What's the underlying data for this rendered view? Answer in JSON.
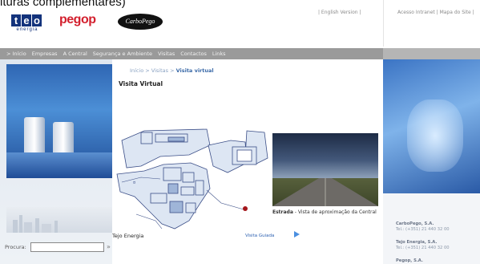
{
  "top_caption": "ituras complementares)",
  "header": {
    "logo_tejo": "tejo",
    "logo_tejo_sub": "energia",
    "logo_pegop": "pegop",
    "logo_carbo": "CarboPego",
    "english_version": "| English Version |",
    "intranet_links": "Acesso Intranet | Mapa do Site |"
  },
  "nav": {
    "items": [
      "> Início",
      "Empresas",
      "A Central",
      "Segurança e Ambiente",
      "Visitas",
      "Contactos",
      "Links"
    ]
  },
  "search": {
    "label": "Procura:",
    "value": "",
    "go": "»"
  },
  "main": {
    "breadcrumb_prefix": "Início > Visitas > ",
    "breadcrumb_current": "Visita virtual",
    "title": "Visita Virtual",
    "photo_caption_bold": "Estrada",
    "photo_caption_rest": " - Vista de aproximação da Central",
    "company_name": "Tejo Energia",
    "guided_link": "Visita Guiada"
  },
  "contacts": [
    {
      "name": "CarboPego, S.A.",
      "tel": "Tel.: (+351) 21 440 32 00"
    },
    {
      "name": "Tejo Energia, S.A.",
      "tel": "Tel.: (+351) 21 440 32 00"
    },
    {
      "name": "Pegop, S.A.",
      "tel": ""
    }
  ],
  "colors": {
    "brand_blue": "#13337c",
    "pegop_red": "#d3202e",
    "nav_gray": "#9a9a9a",
    "link_blue": "#2a5fb0",
    "marker_red": "#a4161b"
  }
}
